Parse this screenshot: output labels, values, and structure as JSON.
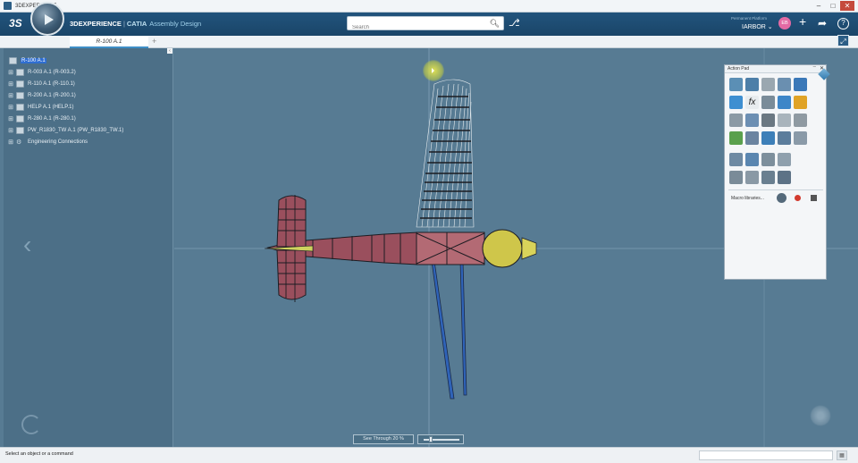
{
  "window": {
    "title": "3DEXPERIENCE",
    "minimize": "–",
    "maximize": "□",
    "close": "✕"
  },
  "header": {
    "logo": "3S",
    "brand": "3DEXPERIENCE",
    "separator": "|",
    "app": "CATIA",
    "module": "Assembly Design",
    "search_placeholder": "Search",
    "platform_label": "Permanent Platform",
    "user": "IARBOR",
    "avatar_initials": "EB"
  },
  "tabs": [
    {
      "label": "R-100 A.1"
    }
  ],
  "tree": {
    "items": [
      {
        "label": "R-100 A.1"
      },
      {
        "label": "R-003 A.1 (R-003.2)"
      },
      {
        "label": "R-110 A.1 (R-110.1)"
      },
      {
        "label": "R-200 A.1 (R-200.1)"
      },
      {
        "label": "HELP A.1 (HELP.1)"
      },
      {
        "label": "R-280 A.1 (R-280.1)"
      },
      {
        "label": "PW_R1830_TW A.1 (PW_R1830_TW.1)"
      },
      {
        "label": "Engineering Connections"
      }
    ]
  },
  "action_pad": {
    "title": "Action Pad",
    "macro_label": "Macro libraries..."
  },
  "see_through": {
    "label": "See Through",
    "value": "20 %",
    "level": 0.2
  },
  "status": {
    "message": "Select an object or a command"
  }
}
